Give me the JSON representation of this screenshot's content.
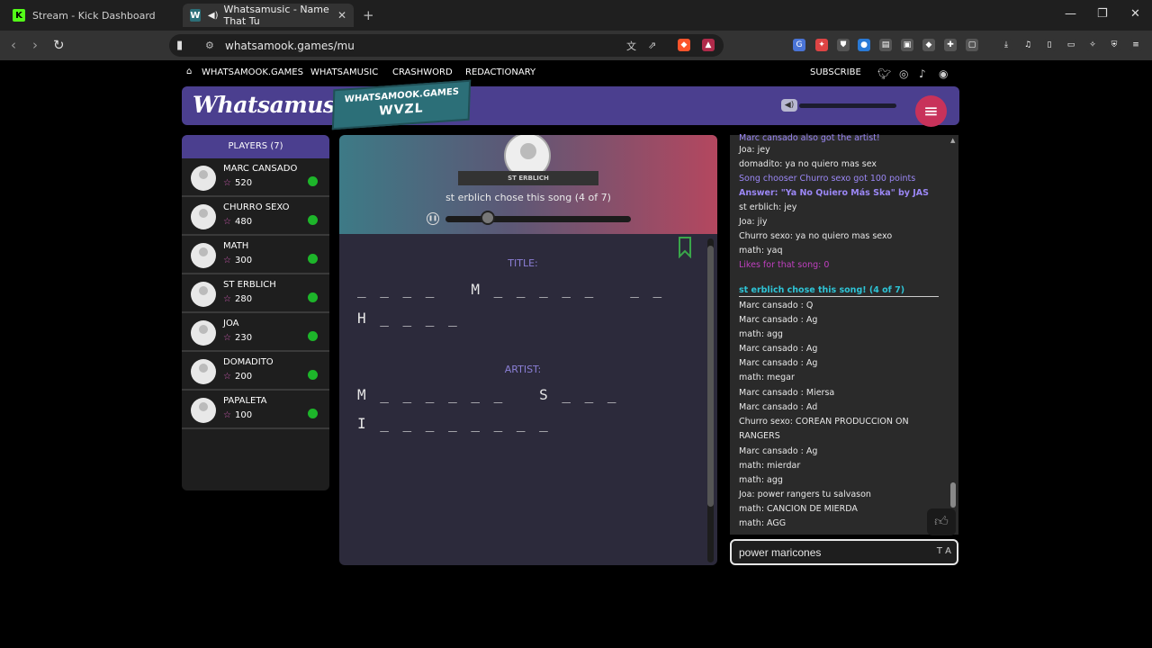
{
  "browser": {
    "tabs": [
      {
        "title": "Stream - Kick Dashboard",
        "favicon": "K"
      },
      {
        "title": "Whatsamusic - Name That Tu",
        "favicon": "W"
      }
    ],
    "url": "whatsamook.games/mu"
  },
  "topnav": {
    "items": [
      "WHATSAMOOK.GAMES",
      "WHATSAMUSIC",
      "CRASHWORD",
      "REDACTIONARY"
    ],
    "subscribe": "SUBSCRIBE"
  },
  "header": {
    "logo": "Whatsamusic",
    "badge_top": "WHATSAMOOK.GAMES",
    "badge_code": "WVZL"
  },
  "players": {
    "title": "PLAYERS (7)",
    "list": [
      {
        "name": "MARC CANSADO",
        "points": "520"
      },
      {
        "name": "CHURRO SEXO",
        "points": "480"
      },
      {
        "name": "MATH",
        "points": "300"
      },
      {
        "name": "ST ERBLICH",
        "points": "280"
      },
      {
        "name": "JOA",
        "points": "230"
      },
      {
        "name": "DOMADITO",
        "points": "200"
      },
      {
        "name": "PAPALETA",
        "points": "100"
      }
    ]
  },
  "game": {
    "chooser": "ST ERBLICH",
    "chose_text": "st erblich chose this song (4 of 7)",
    "progress": 0.23,
    "title_label": "TITLE:",
    "title_line1": "_ _ _ _   M _ _ _ _ _   _ _",
    "title_line2": "H _ _ _ _",
    "artist_label": "ARTIST:",
    "artist_line1": "M _ _ _ _ _ _   S _ _ _",
    "artist_line2": "I _ _ _ _ _ _ _ _"
  },
  "chat": {
    "lines": [
      {
        "text": "Marc cansado also got the artist!",
        "style": "sys"
      },
      {
        "text": "Joa: jey",
        "style": ""
      },
      {
        "text": "domadito: ya no quiero mas sex",
        "style": ""
      },
      {
        "text": "Song chooser Churro sexo got 100 points",
        "style": "sys"
      },
      {
        "text": "Answer: \"Ya No Quiero Más Ska\" by JAS",
        "style": "bold"
      },
      {
        "text": "st erblich: jey",
        "style": ""
      },
      {
        "text": "Joa: jiy",
        "style": ""
      },
      {
        "text": "Churro sexo: ya no quiero mas sexo",
        "style": ""
      },
      {
        "text": "math: yaq",
        "style": ""
      },
      {
        "text": "Likes for that song: 0",
        "style": "pink"
      },
      {
        "text": "st erblich chose this song! (4 of 7)",
        "style": "cyan"
      },
      {
        "text": "Marc cansado : Q",
        "style": ""
      },
      {
        "text": "Marc cansado : Ag",
        "style": ""
      },
      {
        "text": "math: agg",
        "style": ""
      },
      {
        "text": "Marc cansado : Ag",
        "style": ""
      },
      {
        "text": "Marc cansado : Ag",
        "style": ""
      },
      {
        "text": "math: megar",
        "style": ""
      },
      {
        "text": "Marc cansado : Miersa",
        "style": ""
      },
      {
        "text": "Marc cansado : Ad",
        "style": ""
      },
      {
        "text": "Churro sexo: COREAN PRODUCCION ON",
        "style": ""
      },
      {
        "text": "RANGERS",
        "style": ""
      },
      {
        "text": "Marc cansado : Ag",
        "style": ""
      },
      {
        "text": "math: mierdar",
        "style": ""
      },
      {
        "text": "math: agg",
        "style": ""
      },
      {
        "text": "Joa: power rangers tu salvason",
        "style": ""
      },
      {
        "text": "math: CANCION DE MIERDA",
        "style": ""
      },
      {
        "text": "math: AGG",
        "style": ""
      }
    ],
    "input_value": "power maricones",
    "input_suffix": "T A"
  },
  "colors": {
    "accent": "#4b3f8f",
    "menu": "#c8325a",
    "online": "#1db52a"
  }
}
